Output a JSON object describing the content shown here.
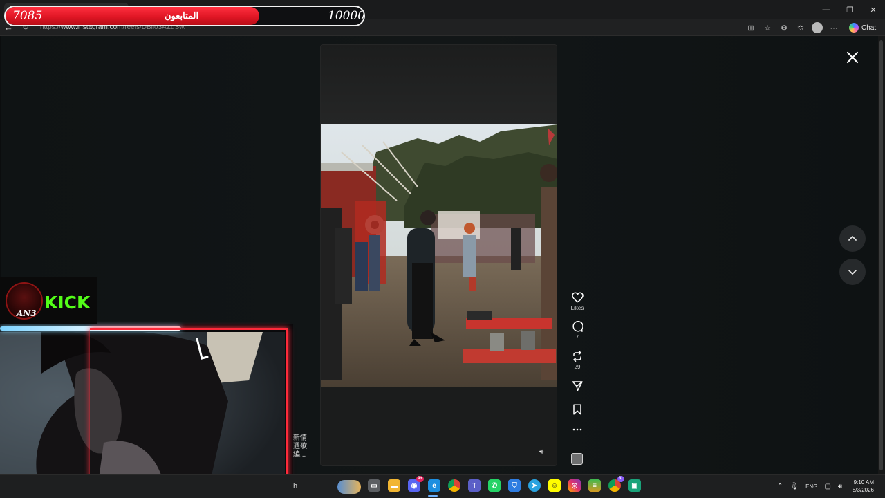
{
  "browser": {
    "url_prefix": "https://",
    "url_domain": "www.instagram.com",
    "url_path": "/reels/DBllo3AZqSw/",
    "chat_label": "Chat",
    "window_controls": [
      "—",
      "❐",
      "✕"
    ]
  },
  "follower_bar": {
    "current": "7085",
    "label": "المتابعون",
    "goal": "10000",
    "progress_fraction": 0.7085
  },
  "reel": {
    "actions": {
      "like_label": "Likes",
      "comment_count": "7",
      "repost_count": "29"
    }
  },
  "overlay": {
    "kick_text": "KICK",
    "logo_text": "AN3"
  },
  "side_text": {
    "line1": "新情",
    "line2": "週歌",
    "line3": "編..."
  },
  "taskbar": {
    "search_fragment": "h",
    "language": "ENG",
    "time": "9:10 AM",
    "date": "8/3/2026",
    "discord_badge": "9+",
    "chrome_badge": "3"
  },
  "colors": {
    "follower_fill": "#e01624",
    "kick_green": "#53fc18",
    "webcam_border": "#ff2a3a"
  }
}
